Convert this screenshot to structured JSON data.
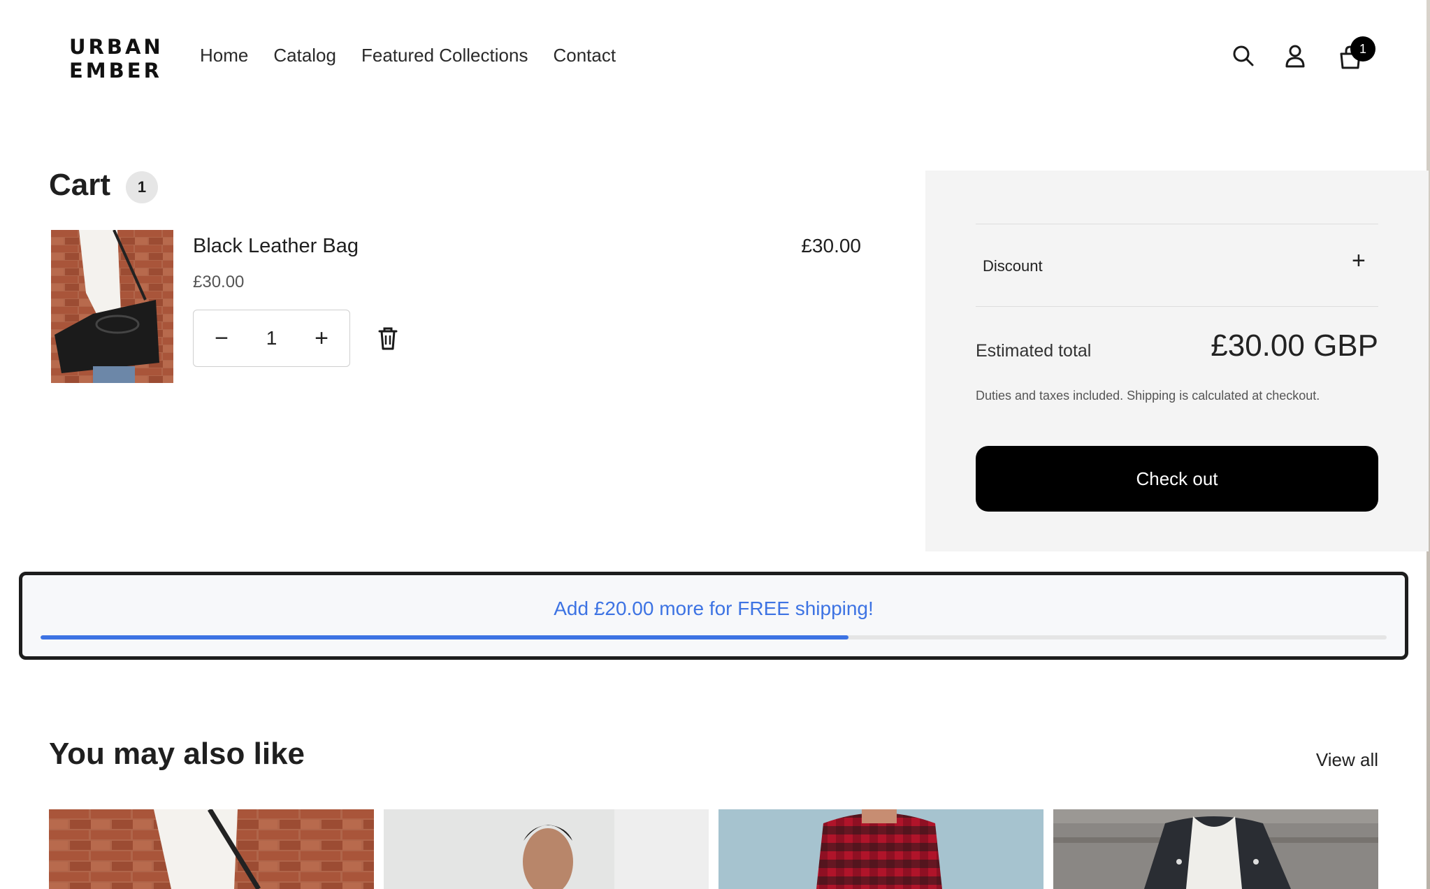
{
  "header": {
    "logo_line1": "URBAN",
    "logo_line2": "EMBER",
    "nav": [
      "Home",
      "Catalog",
      "Featured Collections",
      "Contact"
    ],
    "icons": [
      "search-icon",
      "account-icon",
      "cart-icon"
    ],
    "cart_count": "1"
  },
  "cart": {
    "title": "Cart",
    "count": "1",
    "item": {
      "name": "Black Leather Bag",
      "unit_price": "£30.00",
      "line_total": "£30.00",
      "quantity": "1",
      "minus_symbol": "−",
      "plus_symbol": "+"
    }
  },
  "summary": {
    "discount_label": "Discount",
    "discount_toggle": "+",
    "estimated_label": "Estimated total",
    "estimated_value": "£30.00 GBP",
    "duties_note": "Duties and taxes included. Shipping is calculated at checkout.",
    "checkout_label": "Check out"
  },
  "shipping": {
    "message": "Add £20.00 more for FREE shipping!",
    "progress": 0.6,
    "accent": "#3d73e3"
  },
  "recommendations": {
    "title": "You may also like",
    "view_all": "View all",
    "products": [
      "bag-photo",
      "portrait-photo",
      "flannel-shirt-photo",
      "quilted-jacket-photo"
    ]
  },
  "colors": {
    "panel_bg": "#f4f4f4",
    "button_bg": "#000000",
    "badge_bg": "#e6e6e6"
  }
}
